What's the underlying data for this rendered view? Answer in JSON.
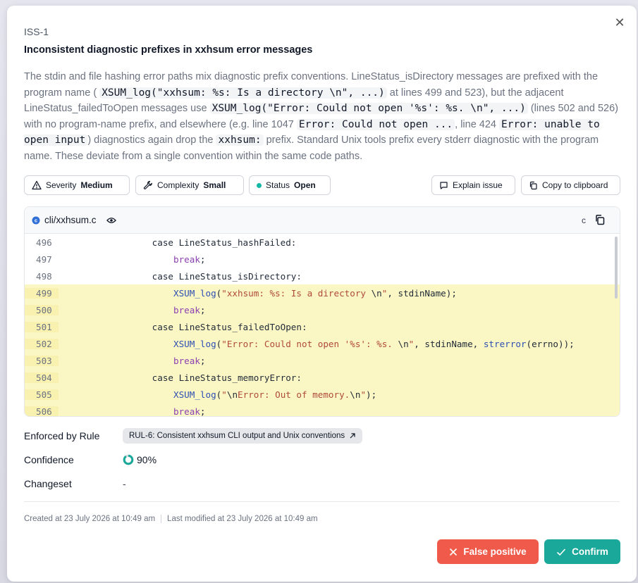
{
  "issue": {
    "id": "ISS-1",
    "title": "Inconsistent diagnostic prefixes in xxhsum error messages",
    "description": [
      {
        "t": "text",
        "v": "The stdin and file hashing error paths mix diagnostic prefix conventions. LineStatus_isDirectory messages are prefixed with the program name ( "
      },
      {
        "t": "code",
        "v": "XSUM_log(\"xxhsum: %s: Is a directory \\n\", ...)"
      },
      {
        "t": "text",
        "v": " at lines 499 and 523), but the adjacent LineStatus_failedToOpen messages use "
      },
      {
        "t": "code",
        "v": "XSUM_log(\"Error: Could not open '%s': %s. \\n\", ...)"
      },
      {
        "t": "text",
        "v": " (lines 502 and 526) with no program-name prefix, and elsewhere (e.g. line 1047 "
      },
      {
        "t": "code",
        "v": "Error: Could not open ..."
      },
      {
        "t": "text",
        "v": ", line 424 "
      },
      {
        "t": "code",
        "v": "Error: unable to open input"
      },
      {
        "t": "text",
        "v": ") diagnostics again drop the "
      },
      {
        "t": "code",
        "v": "xxhsum:"
      },
      {
        "t": "text",
        "v": " prefix. Standard Unix tools prefix every stderr diagnostic with the program name. These deviate from a single convention within the same code paths."
      }
    ]
  },
  "pills": {
    "severity_label": "Severity",
    "severity_value": "Medium",
    "complexity_label": "Complexity",
    "complexity_value": "Small",
    "status_label": "Status",
    "status_value": "Open",
    "explain_label": "Explain issue",
    "copy_label": "Copy to clipboard"
  },
  "code": {
    "file": "cli/xxhsum.c",
    "language": "c",
    "lines": [
      {
        "n": "496",
        "hl": false,
        "tokens": [
          [
            "",
            "        case LineStatus_hashFailed:"
          ]
        ]
      },
      {
        "n": "497",
        "hl": false,
        "tokens": [
          [
            "",
            "            "
          ],
          [
            "kw",
            "break"
          ],
          [
            "",
            ";"
          ]
        ]
      },
      {
        "n": "498",
        "hl": false,
        "tokens": [
          [
            "",
            "        case LineStatus_isDirectory:"
          ]
        ]
      },
      {
        "n": "499",
        "hl": true,
        "tokens": [
          [
            "",
            "            "
          ],
          [
            "fn",
            "XSUM_log"
          ],
          [
            "",
            "("
          ],
          [
            "str",
            "\"xxhsum: %s: Is a directory "
          ],
          [
            "",
            "\\n"
          ],
          [
            "str",
            "\""
          ],
          [
            "",
            ", stdinName);"
          ]
        ]
      },
      {
        "n": "500",
        "hl": true,
        "tokens": [
          [
            "",
            "            "
          ],
          [
            "kw",
            "break"
          ],
          [
            "",
            ";"
          ]
        ]
      },
      {
        "n": "501",
        "hl": true,
        "tokens": [
          [
            "",
            "        case LineStatus_failedToOpen:"
          ]
        ]
      },
      {
        "n": "502",
        "hl": true,
        "tokens": [
          [
            "",
            "            "
          ],
          [
            "fn",
            "XSUM_log"
          ],
          [
            "",
            "("
          ],
          [
            "str",
            "\"Error: Could not open '%s': %s. "
          ],
          [
            "",
            "\\n"
          ],
          [
            "str",
            "\""
          ],
          [
            "",
            ", stdinName, "
          ],
          [
            "fn",
            "strerror"
          ],
          [
            "",
            "(errno));"
          ]
        ]
      },
      {
        "n": "503",
        "hl": true,
        "tokens": [
          [
            "",
            "            "
          ],
          [
            "kw",
            "break"
          ],
          [
            "",
            ";"
          ]
        ]
      },
      {
        "n": "504",
        "hl": true,
        "tokens": [
          [
            "",
            "        case LineStatus_memoryError:"
          ]
        ]
      },
      {
        "n": "505",
        "hl": true,
        "tokens": [
          [
            "",
            "            "
          ],
          [
            "fn",
            "XSUM_log"
          ],
          [
            "",
            "("
          ],
          [
            "str",
            "\""
          ],
          [
            "",
            "\\n"
          ],
          [
            "str",
            "Error: Out of memory."
          ],
          [
            "",
            "\\n"
          ],
          [
            "str",
            "\""
          ],
          [
            "",
            ");"
          ]
        ]
      },
      {
        "n": "506",
        "hl": true,
        "tokens": [
          [
            "",
            "            "
          ],
          [
            "kw",
            "break"
          ],
          [
            "",
            ";"
          ]
        ]
      }
    ]
  },
  "meta": {
    "rule_label": "Enforced by Rule",
    "rule_value": "RUL-6: Consistent xxhsum CLI output and Unix conventions",
    "confidence_label": "Confidence",
    "confidence_value": "90%",
    "confidence_fraction": 0.9,
    "changeset_label": "Changeset",
    "changeset_value": "-"
  },
  "footer": {
    "created": "Created at 23 July 2026 at 10:49 am",
    "modified": "Last modified at 23 July 2026 at 10:49 am",
    "false_positive_label": "False positive",
    "confirm_label": "Confirm"
  },
  "colors": {
    "danger": "#f05a4a",
    "accent": "#19a89a",
    "highlight": "#fbf7c4"
  }
}
